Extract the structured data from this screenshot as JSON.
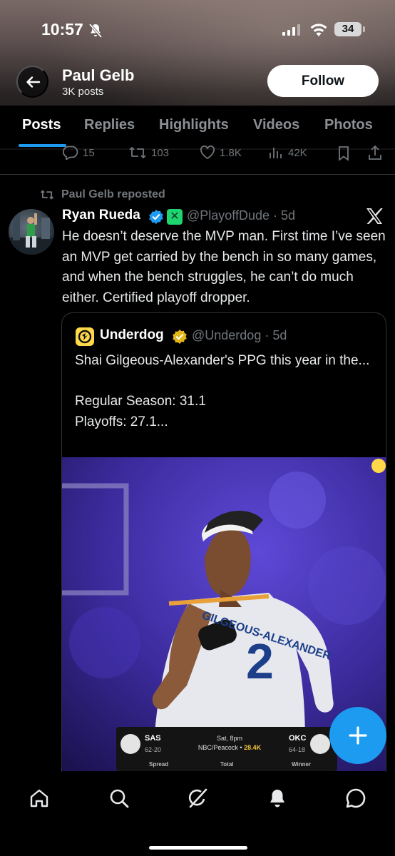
{
  "status_bar": {
    "time": "10:57",
    "battery": "34"
  },
  "header": {
    "name": "Paul Gelb",
    "posts_count": "3K posts",
    "follow_label": "Follow"
  },
  "tabs": [
    {
      "label": "Posts",
      "active": true
    },
    {
      "label": "Replies"
    },
    {
      "label": "Highlights"
    },
    {
      "label": "Videos"
    },
    {
      "label": "Photos"
    }
  ],
  "prev_post_actions": {
    "replies": "15",
    "reposts": "103",
    "likes": "1.8K",
    "views": "42K"
  },
  "post": {
    "repost_label": "Paul Gelb reposted",
    "author_name": "Ryan Rueda",
    "handle_time": "@PlayoffDude · 5d",
    "text": "He doesn’t deserve the MVP man. First time I’ve seen an MVP get carried by the bench in so many games, and when the bench struggles, he can’t do much either. Certified playoff dropper."
  },
  "quote": {
    "author_name": "Underdog",
    "handle_time": "@Underdog · 5d",
    "text": "Shai Gilgeous-Alexander's PPG this year in the...\n\nRegular Season: 31.1\nPlayoffs: 27.1...",
    "jersey_name": "GILGEOUS-ALEXANDER",
    "jersey_number": "2",
    "scoreboard": {
      "away_team": "SAS",
      "away_record": "62-20",
      "game_time": "Sat, 8pm",
      "broadcast": "NBC/Peacock",
      "entries": "28.4K",
      "home_team": "OKC",
      "home_record": "64-18",
      "col_spread": "Spread",
      "col_total": "Total",
      "col_winner": "Winner"
    }
  },
  "colors": {
    "accent": "#1d9bf0",
    "background": "#000000",
    "muted": "#71767b"
  },
  "icons": [
    "back-arrow-icon",
    "bell-off-icon",
    "signal-icon",
    "wifi-icon",
    "reply-icon",
    "repost-icon",
    "like-icon",
    "views-icon",
    "bookmark-icon",
    "share-icon",
    "verified-badge-icon",
    "x-logo-icon",
    "compose-plus-icon",
    "home-icon",
    "search-icon",
    "grok-icon",
    "notifications-icon",
    "messages-icon"
  ]
}
